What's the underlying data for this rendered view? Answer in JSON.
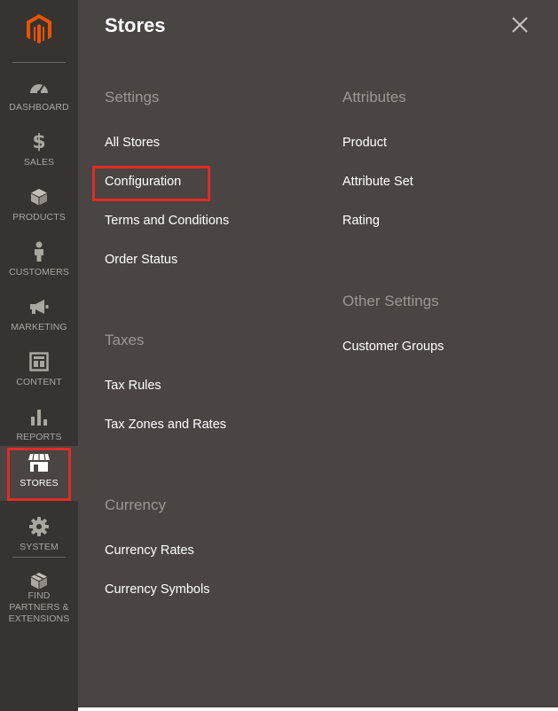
{
  "nav": {
    "items": [
      {
        "key": "dashboard",
        "label": "DASHBOARD",
        "icon": "dashboard-icon"
      },
      {
        "key": "sales",
        "label": "SALES",
        "icon": "dollar-icon"
      },
      {
        "key": "products",
        "label": "PRODUCTS",
        "icon": "cube-icon"
      },
      {
        "key": "customers",
        "label": "CUSTOMERS",
        "icon": "person-icon"
      },
      {
        "key": "marketing",
        "label": "MARKETING",
        "icon": "megaphone-icon"
      },
      {
        "key": "content",
        "label": "CONTENT",
        "icon": "layout-icon"
      },
      {
        "key": "reports",
        "label": "REPORTS",
        "icon": "bar-chart-icon"
      },
      {
        "key": "stores",
        "label": "STORES",
        "icon": "storefront-icon",
        "active": true
      },
      {
        "key": "system",
        "label": "SYSTEM",
        "icon": "gear-icon"
      },
      {
        "key": "partners",
        "label": "FIND PARTNERS & EXTENSIONS",
        "icon": "box-icon"
      }
    ]
  },
  "panel": {
    "title": "Stores",
    "close_icon": "close-icon",
    "sections": {
      "settings": {
        "title": "Settings",
        "links": [
          "All Stores",
          "Configuration",
          "Terms and Conditions",
          "Order Status"
        ]
      },
      "taxes": {
        "title": "Taxes",
        "links": [
          "Tax Rules",
          "Tax Zones and Rates"
        ]
      },
      "currency": {
        "title": "Currency",
        "links": [
          "Currency Rates",
          "Currency Symbols"
        ]
      },
      "attributes": {
        "title": "Attributes",
        "links": [
          "Product",
          "Attribute Set",
          "Rating"
        ]
      },
      "other": {
        "title": "Other Settings",
        "links": [
          "Customer Groups"
        ]
      }
    }
  },
  "colors": {
    "sidebar_bg": "#373330",
    "panel_bg": "#4a4542",
    "section_title": "#9d9691",
    "highlight": "#e02b27",
    "brand": "#eb5202"
  }
}
